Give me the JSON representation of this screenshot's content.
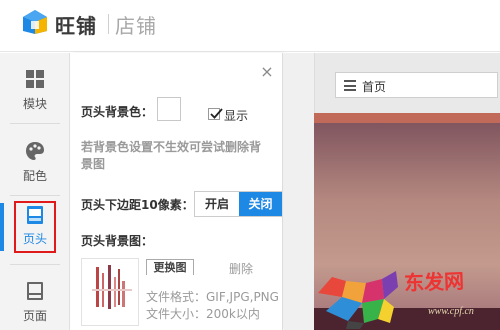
{
  "header": {
    "brand": "旺铺",
    "sub": "店铺"
  },
  "sidebar": {
    "items": [
      {
        "label": "模块",
        "icon": "grid-icon"
      },
      {
        "label": "配色",
        "icon": "palette-icon"
      },
      {
        "label": "页头",
        "icon": "page-header-icon",
        "active": true
      },
      {
        "label": "页面",
        "icon": "page-icon"
      }
    ]
  },
  "panel": {
    "bg_color_label": "页头背景色：",
    "show_label": "显示",
    "show_checked": true,
    "hint": "若背景色设置不生效可尝试删除背景图",
    "margin_label": "页头下边距10像素：",
    "toggle_on": "开启",
    "toggle_off": "关闭",
    "toggle_selected": "关闭",
    "bg_image_label": "页头背景图：",
    "replace_label": "更换图",
    "delete_label": "删除",
    "format_text": "文件格式：GIF,JPG,PNG",
    "size_text": "文件大小：200k以内"
  },
  "preview": {
    "nav_label": "首页"
  },
  "watermark": {
    "text": "东发网",
    "url": "www.cpf.cn"
  },
  "colors": {
    "accent": "#1e88e5",
    "highlight": "#e01a1a"
  }
}
